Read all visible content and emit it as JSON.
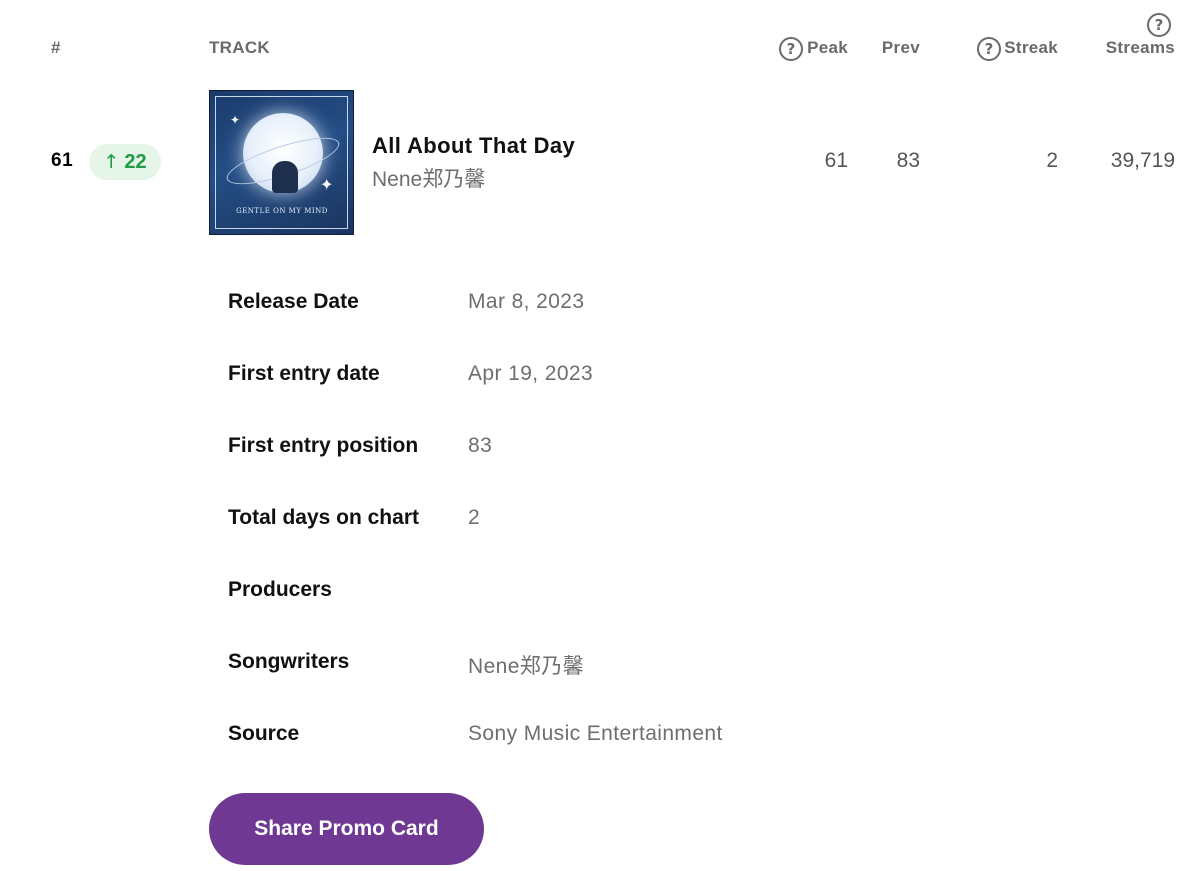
{
  "header": {
    "rank": "#",
    "track": "TRACK",
    "peak": "Peak",
    "prev": "Prev",
    "streak": "Streak",
    "streams": "Streams",
    "help_glyph": "?"
  },
  "row": {
    "rank": "61",
    "change": "22",
    "change_direction": "up",
    "change_arrow": "↑",
    "title": "All About That Day",
    "artist": "Nene郑乃馨",
    "cover_text": "GENTLE ON MY MIND",
    "peak": "61",
    "prev": "83",
    "streak": "2",
    "streams": "39,719"
  },
  "details": [
    {
      "label": "Release Date",
      "value": "Mar 8, 2023"
    },
    {
      "label": "First entry date",
      "value": "Apr 19, 2023"
    },
    {
      "label": "First entry position",
      "value": "83"
    },
    {
      "label": "Total days on chart",
      "value": "2"
    },
    {
      "label": "Producers",
      "value": ""
    },
    {
      "label": "Songwriters",
      "value": "Nene郑乃馨"
    },
    {
      "label": "Source",
      "value": "Sony Music Entertainment"
    }
  ],
  "actions": {
    "share_label": "Share Promo Card"
  },
  "colors": {
    "accent_button": "#6f3893",
    "change_up_text": "#1e9c43",
    "change_up_bg": "#e5f5e8"
  }
}
